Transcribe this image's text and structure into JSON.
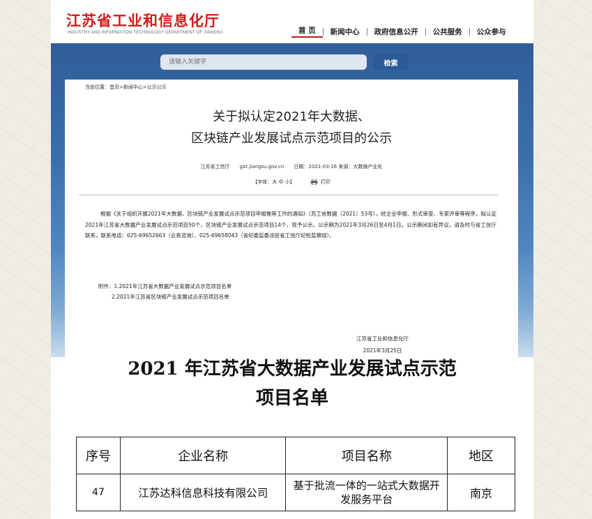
{
  "site": {
    "name_cn": "江苏省工业和信息化厅",
    "name_en": "INDUSTRY AND INFORMATION TECHNOLOGY DEPARTMENT OF JIANGSU"
  },
  "nav": [
    "首 页",
    "新闻中心",
    "政府信息公开",
    "公共服务",
    "公众参与"
  ],
  "search": {
    "placeholder": "请输入关键字",
    "button": "检索"
  },
  "article": {
    "breadcrumb": "当前位置：首页>新闻中心>公示公示",
    "title_line1": "关于拟认定2021年大数据、",
    "title_line2": "区块链产业发展试点示范项目的公示",
    "meta": "江苏省工信厅　　gxt.jiangsu.gov.cn　　日期：2021-03-26 来源：大数据产业处",
    "font_size_label": "【字体：大 中 小】",
    "print_label": "打印",
    "body": "根据《关于组织开展2021年大数据、区块链产业发展试点示范项目申报推荐工作的通知》（苏工信数据〔2021〕53号），经企业申报、形式审查、专家评审等程序，拟认定2021年江苏省大数据产业发展试点示范项目50个，区块链产业发展试点示范项目14个，现予公示。公示期为2021年3月26日至4月1日。公示期间如有异议，请及时与省工信厅联系，联系电话：025-69652663（业务咨询）、025-69658043（省纪委监委派驻省工信厅纪检监察组）。",
    "attachments": [
      "附件：1.2021年江苏省大数据产业发展试点示范项目名单",
      "2.2021年江苏省区块链产业发展试点示范项目名单"
    ],
    "signer": "江苏省工业和信息化厅",
    "sign_date": "2021年3月25日"
  },
  "list": {
    "title_line1": "2021 年江苏省大数据产业发展试点示范",
    "title_line2": "项目名单",
    "headers": [
      "序号",
      "企业名称",
      "项目名称",
      "地区"
    ],
    "rows": [
      {
        "seq": "47",
        "company": "江苏达科信息科技有限公司",
        "project": "基于批流一体的一站式大数据开发服务平台",
        "region": "南京"
      }
    ]
  },
  "colors": {
    "brand_red": "#d41a1a",
    "banner_blue": "#3a6eab",
    "button_blue": "#2a5a97"
  }
}
